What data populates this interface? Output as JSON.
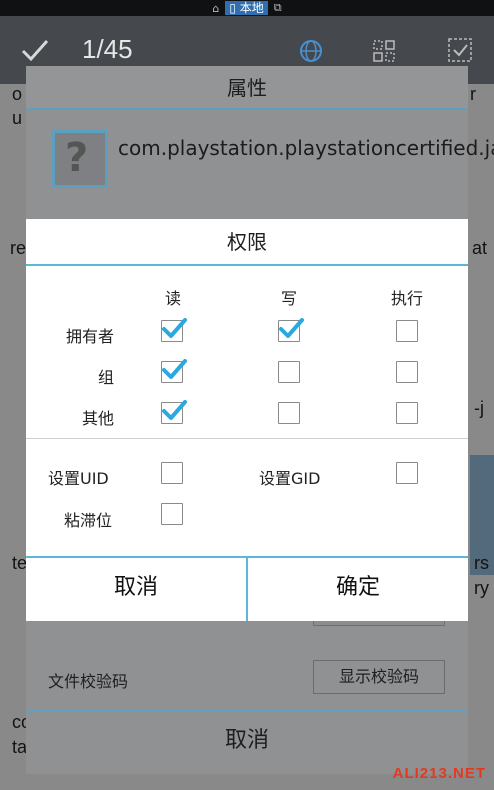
{
  "status_bar": {
    "storage_label": "本地"
  },
  "app_bar": {
    "counter": "1/45"
  },
  "background_fragments": [
    "o",
    "r",
    "u",
    "re",
    "at",
    "-j",
    "te",
    "rs",
    "ry",
    "co",
    "ta"
  ],
  "properties_dialog": {
    "title": "属性",
    "file_name": "com.playstation.playstationcertified.jar",
    "checksum_label": "文件校验码",
    "checksum_button": "显示校验码",
    "cancel_button": "取消"
  },
  "permissions_dialog": {
    "title": "权限",
    "columns": [
      "读",
      "写",
      "执行"
    ],
    "rows": [
      {
        "label": "拥有者",
        "read": true,
        "write": true,
        "execute": false
      },
      {
        "label": "组",
        "read": true,
        "write": false,
        "execute": false
      },
      {
        "label": "其他",
        "read": true,
        "write": false,
        "execute": false
      }
    ],
    "set_uid_label": "设置UID",
    "set_uid_checked": false,
    "set_gid_label": "设置GID",
    "set_gid_checked": false,
    "sticky_label": "粘滞位",
    "sticky_checked": false,
    "cancel_button": "取消",
    "ok_button": "确定"
  },
  "colors": {
    "accent": "#5cb6d6",
    "check": "#2aa9e0"
  },
  "watermark": "ALI213.NET"
}
